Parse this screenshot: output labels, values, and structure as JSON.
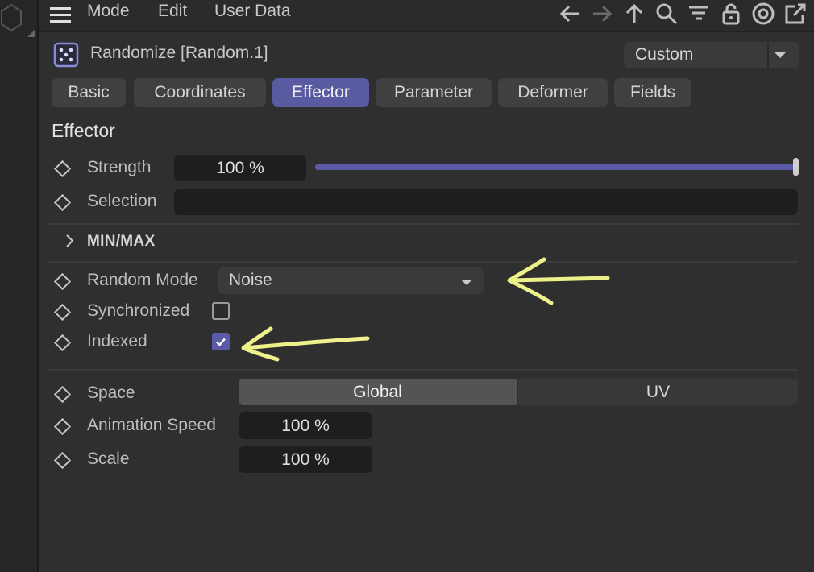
{
  "menubar": {
    "items": [
      "Mode",
      "Edit",
      "User Data"
    ],
    "toolbar_icons": [
      "back-arrow-icon",
      "forward-arrow-icon",
      "up-arrow-icon",
      "search-icon",
      "filter-icon",
      "lock-icon",
      "target-icon",
      "new-window-icon"
    ]
  },
  "header": {
    "title": "Randomize [Random.1]",
    "mode_value": "Custom"
  },
  "tabs": [
    {
      "label": "Basic",
      "active": false
    },
    {
      "label": "Coordinates",
      "active": false
    },
    {
      "label": "Effector",
      "active": true
    },
    {
      "label": "Parameter",
      "active": false
    },
    {
      "label": "Deformer",
      "active": false
    },
    {
      "label": "Fields",
      "active": false
    }
  ],
  "section": {
    "title": "Effector",
    "strength_label": "Strength",
    "strength_value": "100 %",
    "strength_fraction": 1.0,
    "selection_label": "Selection",
    "selection_value": "",
    "minmax_label": "MIN/MAX",
    "random_mode_label": "Random Mode",
    "random_mode_value": "Noise",
    "synchronized_label": "Synchronized",
    "synchronized_checked": false,
    "indexed_label": "Indexed",
    "indexed_checked": true,
    "space_label": "Space",
    "space_options": [
      "Global",
      "UV"
    ],
    "space_selected": "Global",
    "animation_speed_label": "Animation Speed",
    "animation_speed_value": "100 %",
    "scale_label": "Scale",
    "scale_value": "100 %"
  },
  "colors": {
    "accent": "#5a5aa8",
    "annotation": "#eef08a",
    "background": "#2f2f2f"
  }
}
